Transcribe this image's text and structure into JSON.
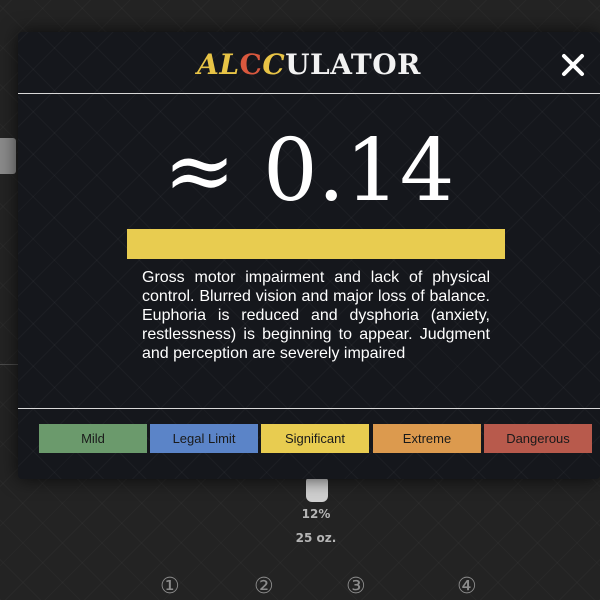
{
  "app": {
    "title_parts": [
      "AL",
      "C",
      "C",
      "ULATOR"
    ],
    "close_icon": "close-icon"
  },
  "result": {
    "bac_display": "≈ 0.14",
    "level": "Significant",
    "level_color": "#e8cc50",
    "description": "Gross motor impairment and lack of physical control. Blurred vision and major loss of balance. Euphoria is reduced and dysphoria (anxiety, restlessness) is beginning to appear. Judgment and perception are severely impaired"
  },
  "legend": [
    {
      "label": "Mild",
      "color": "#6b9a6c"
    },
    {
      "label": "Legal Limit",
      "color": "#5b84c8"
    },
    {
      "label": "Significant",
      "color": "#e8cc50"
    },
    {
      "label": "Extreme",
      "color": "#dc9a4e"
    },
    {
      "label": "Dangerous",
      "color": "#b85a4c"
    }
  ],
  "background": {
    "percent": "12%",
    "ounces": "25 oz.",
    "steps": [
      "①",
      "②",
      "③",
      "④"
    ]
  }
}
